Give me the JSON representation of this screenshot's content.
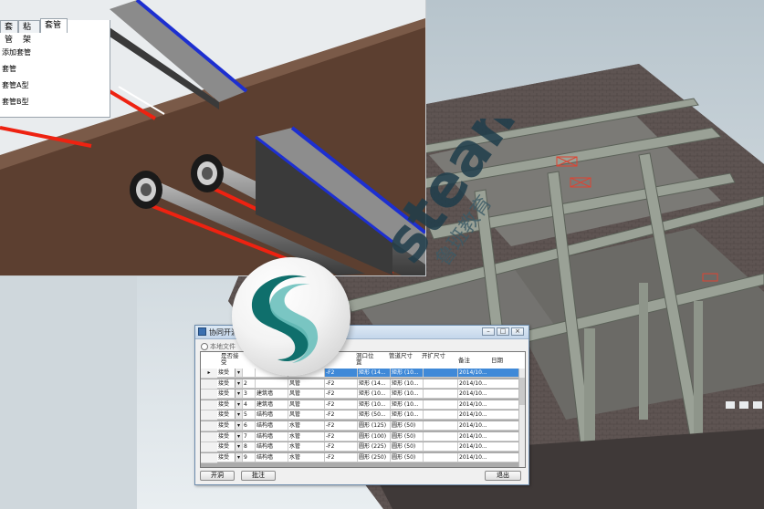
{
  "palette": {
    "tabs": [
      "套管",
      "粘架",
      "套管"
    ],
    "items": [
      "添加套管",
      "套管",
      "套管A型",
      "套管B型"
    ]
  },
  "dialog": {
    "title": "协同开洞",
    "scope_label": "本地文件",
    "columns": [
      "",
      "是否接受",
      "",
      "",
      "",
      "洞口位置",
      "管道尺寸",
      "开扩尺寸",
      "备注",
      "日期"
    ],
    "rows": [
      {
        "status": "接受",
        "num": "",
        "type": "",
        "pipe": "",
        "pos": "-F2",
        "size": "矩形 (14...",
        "ext": "矩形 (10...",
        "date": "2014/10..."
      },
      {
        "status": "接受",
        "num": "2",
        "type": "",
        "pipe": "风管",
        "pos": "-F2",
        "size": "矩形 (14...",
        "ext": "矩形 (10...",
        "date": "2014/10..."
      },
      {
        "status": "接受",
        "num": "3",
        "type": "建筑墙",
        "pipe": "风管",
        "pos": "-F2",
        "size": "矩形 (10...",
        "ext": "矩形 (10...",
        "date": "2014/10..."
      },
      {
        "status": "接受",
        "num": "4",
        "type": "建筑墙",
        "pipe": "风管",
        "pos": "-F2",
        "size": "矩形 (10...",
        "ext": "矩形 (10...",
        "date": "2014/10..."
      },
      {
        "status": "接受",
        "num": "5",
        "type": "结构墙",
        "pipe": "风管",
        "pos": "-F2",
        "size": "矩形 (50...",
        "ext": "矩形 (10...",
        "date": "2014/10..."
      },
      {
        "status": "接受",
        "num": "6",
        "type": "结构墙",
        "pipe": "水管",
        "pos": "-F2",
        "size": "圆形 (125)",
        "ext": "圆形 (50)",
        "date": "2014/10..."
      },
      {
        "status": "接受",
        "num": "7",
        "type": "结构墙",
        "pipe": "水管",
        "pos": "-F2",
        "size": "圆形 (100)",
        "ext": "圆形 (50)",
        "date": "2014/10..."
      },
      {
        "status": "接受",
        "num": "8",
        "type": "结构墙",
        "pipe": "水管",
        "pos": "-F2",
        "size": "圆形 (225)",
        "ext": "圆形 (50)",
        "date": "2014/10..."
      },
      {
        "status": "接受",
        "num": "9",
        "type": "结构墙",
        "pipe": "水管",
        "pos": "-F2",
        "size": "圆形 (250)",
        "ext": "圆形 (50)",
        "date": "2014/10..."
      }
    ],
    "buttons": {
      "open": "开洞",
      "approve": "批注",
      "exit": "退出"
    }
  },
  "watermark": {
    "text": "steam",
    "subtext": "鲁班教育"
  }
}
